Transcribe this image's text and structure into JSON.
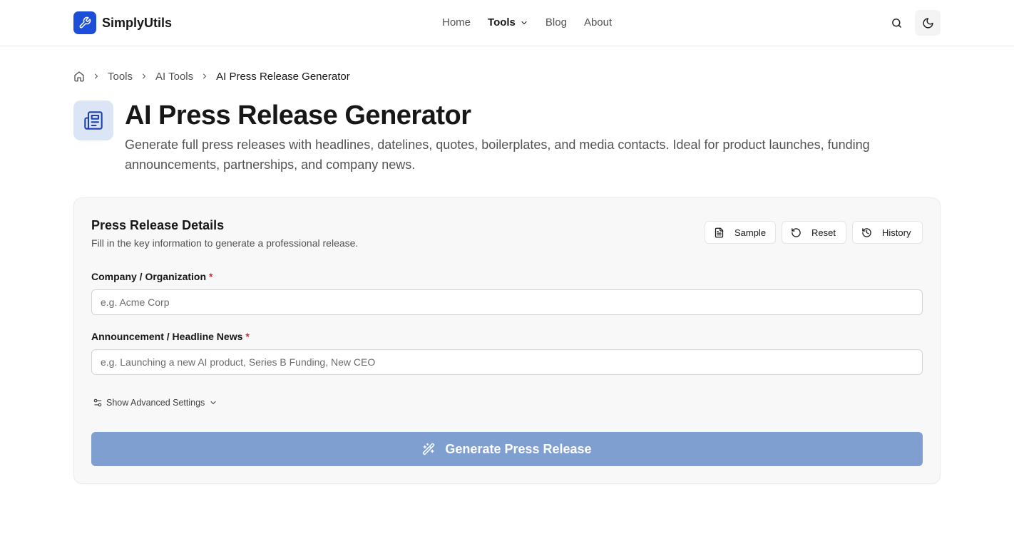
{
  "brand": {
    "name": "SimplyUtils",
    "accent": "#1d4ed8",
    "icon": "wrench-icon"
  },
  "nav": {
    "items": [
      {
        "label": "Home",
        "active": false
      },
      {
        "label": "Tools",
        "active": true,
        "dropdown": true
      },
      {
        "label": "Blog",
        "active": false
      },
      {
        "label": "About",
        "active": false
      }
    ],
    "search_icon": "search-icon",
    "theme_icon": "moon-icon"
  },
  "breadcrumb": {
    "home_icon": "home-icon",
    "items": [
      "Tools",
      "AI Tools",
      "AI Press Release Generator"
    ]
  },
  "page": {
    "icon": "newspaper-icon",
    "title": "AI Press Release Generator",
    "description": "Generate full press releases with headlines, datelines, quotes, boilerplates, and media contacts. Ideal for product launches, funding announcements, partnerships, and company news."
  },
  "form": {
    "title": "Press Release Details",
    "subtitle": "Fill in the key information to generate a professional release.",
    "actions": {
      "sample": "Sample",
      "reset": "Reset",
      "history": "History"
    },
    "fields": {
      "company": {
        "label": "Company / Organization",
        "required_mark": "*",
        "value": "",
        "placeholder": "e.g. Acme Corp"
      },
      "announcement": {
        "label": "Announcement / Headline News",
        "required_mark": "*",
        "value": "",
        "placeholder": "e.g. Launching a new AI product, Series B Funding, New CEO"
      }
    },
    "advanced_toggle": "Show Advanced Settings",
    "submit": "Generate Press Release",
    "submit_color": "#809fd1",
    "required_color": "#dc2626"
  }
}
